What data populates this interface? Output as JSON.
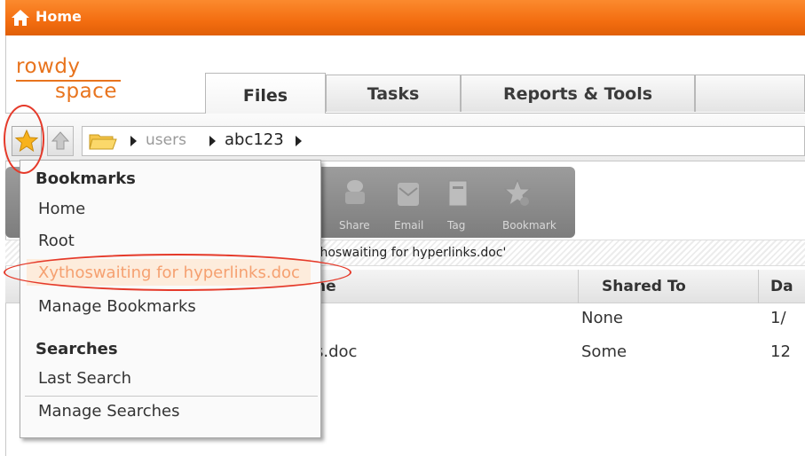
{
  "topbar": {
    "home_label": "Home"
  },
  "logo": {
    "line1": "rowdy",
    "line2": "space"
  },
  "tabs": [
    {
      "label": "Files",
      "active": true
    },
    {
      "label": "Tasks",
      "active": false
    },
    {
      "label": "Reports & Tools",
      "active": false
    }
  ],
  "breadcrumb": {
    "users": "users",
    "current": "abc123"
  },
  "toolbar": {
    "labels": [
      "Share",
      "Email",
      "Tag",
      "Bookmark"
    ]
  },
  "path_row": {
    "text": "thoswaiting for hyperlinks.doc'"
  },
  "table": {
    "headers": {
      "name": "ne",
      "shared_to": "Shared To",
      "date": "Da"
    },
    "rows": [
      {
        "name": "",
        "shared_to": "None",
        "date": "1/"
      },
      {
        "name": "s.doc",
        "shared_to": "Some",
        "date": "12"
      }
    ]
  },
  "menu": {
    "bookmarks_heading": "Bookmarks",
    "bookmarks": [
      "Home",
      "Root",
      "Xythoswaiting for hyperlinks.doc"
    ],
    "manage_bookmarks": "Manage Bookmarks",
    "searches_heading": "Searches",
    "last_search": "Last Search",
    "manage_searches": "Manage Searches"
  },
  "colors": {
    "topbar": "#f36d10",
    "brand": "#e8741e",
    "annotation": "#e53a2a"
  }
}
